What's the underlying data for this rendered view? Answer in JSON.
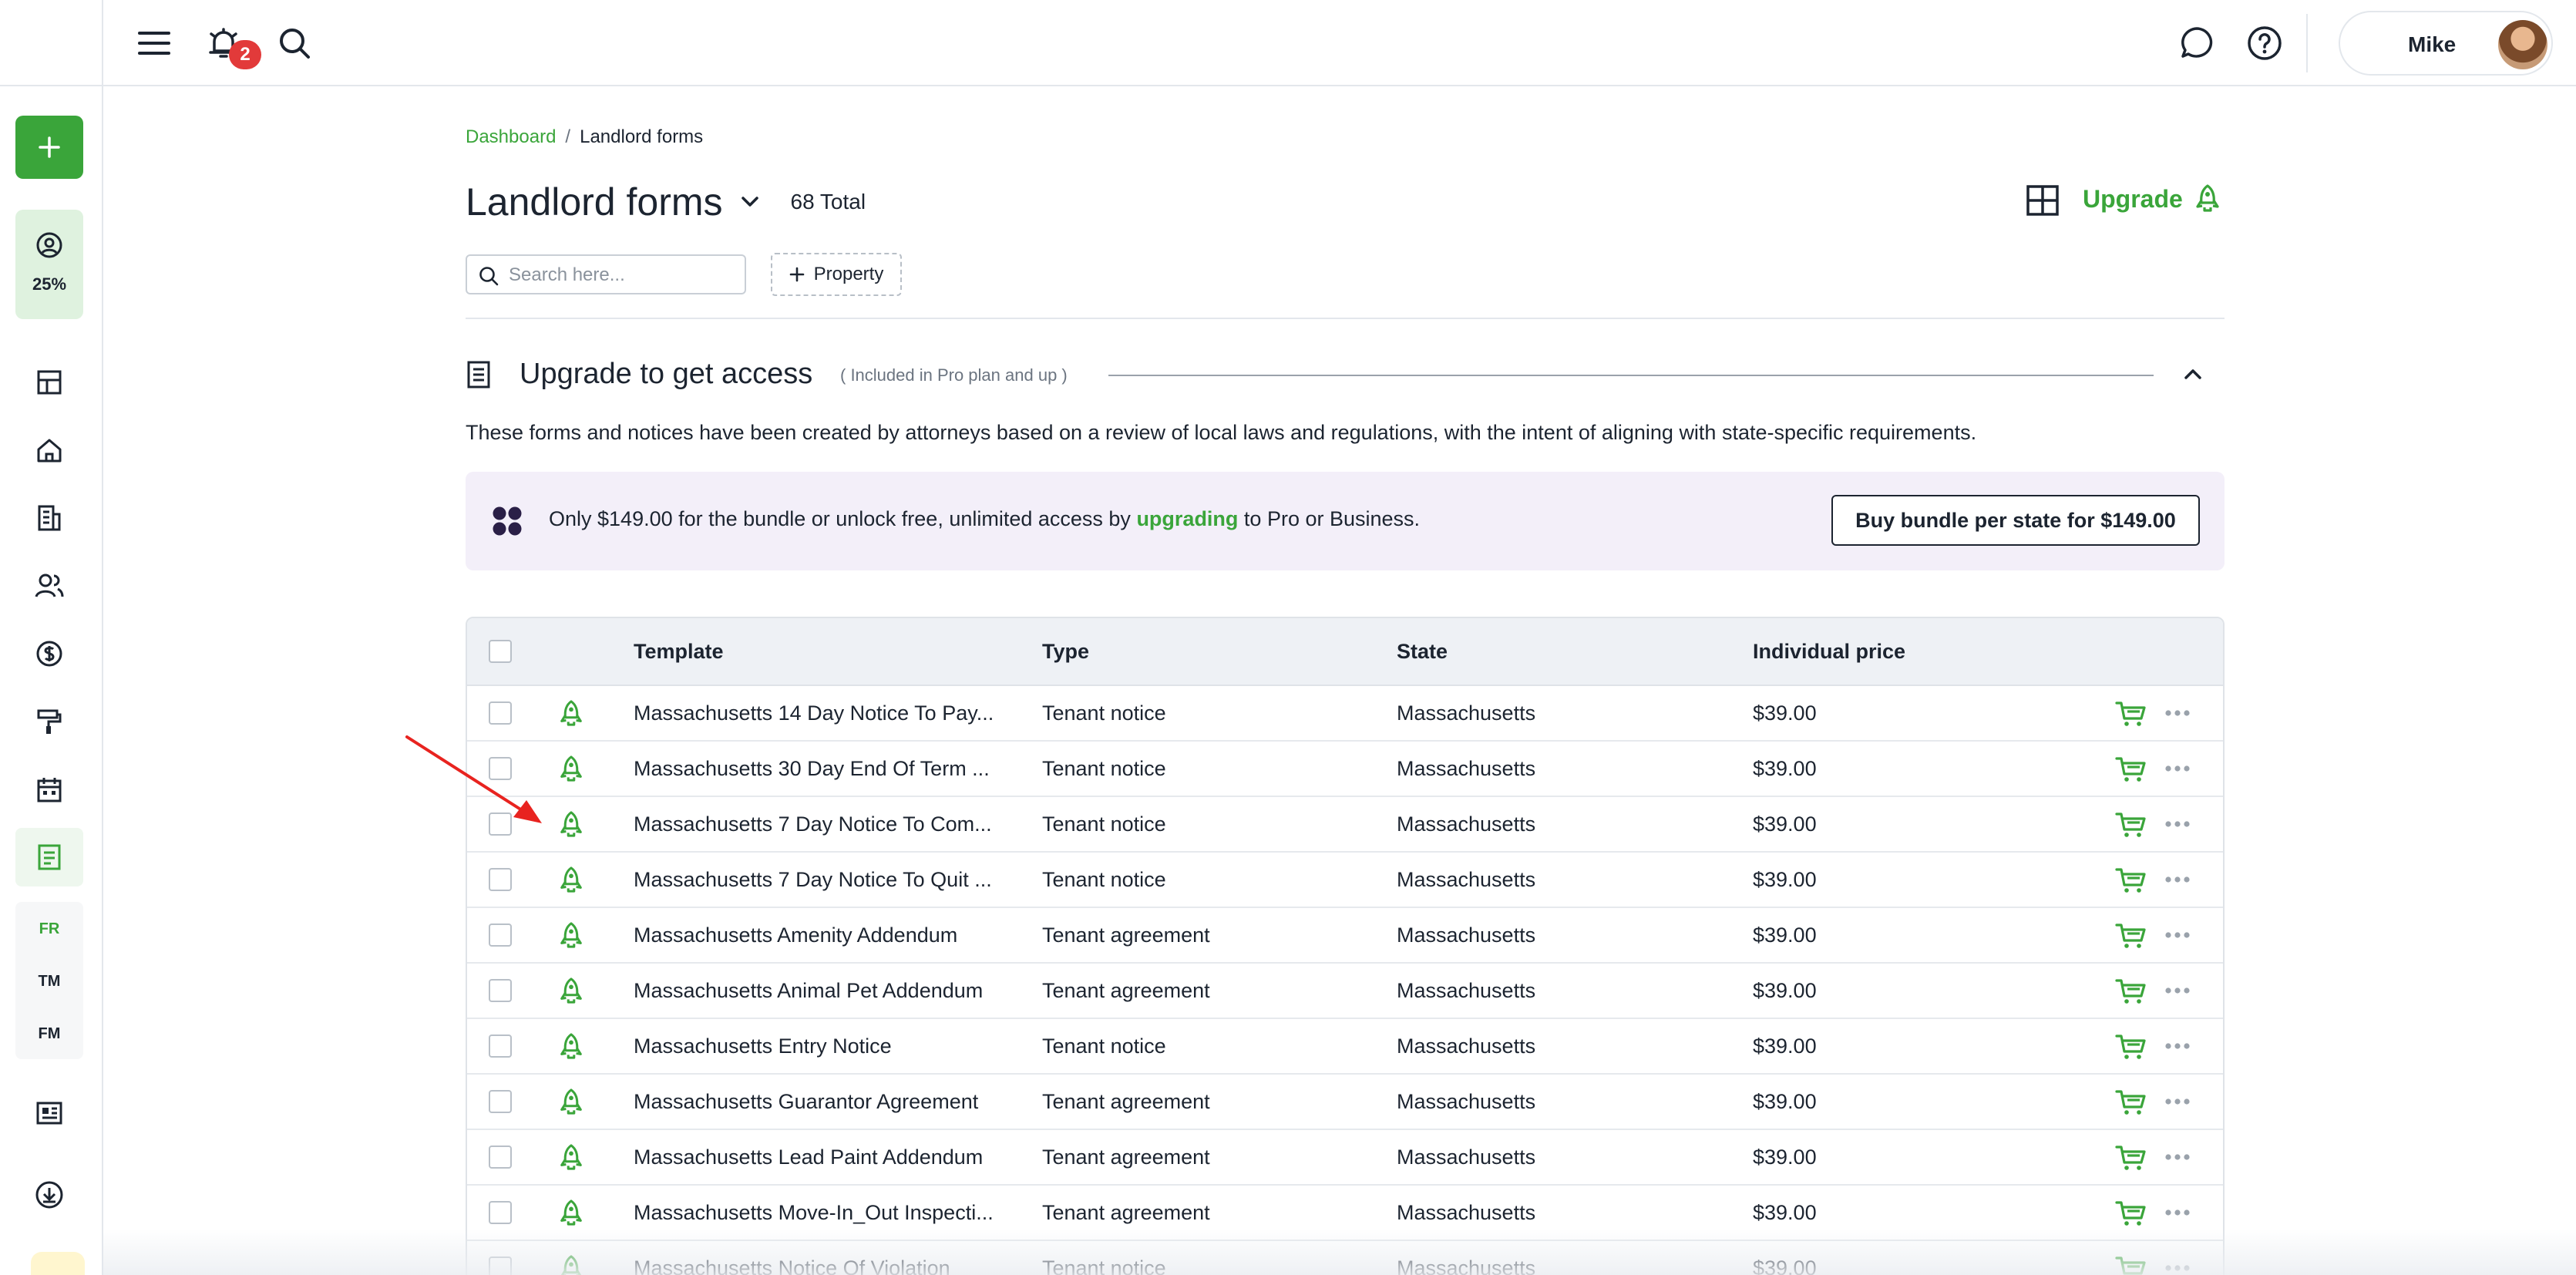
{
  "topbar": {
    "notification_count": "2",
    "user_name": "Mike"
  },
  "sidebar": {
    "progress_label": "25%",
    "tags": [
      "FR",
      "TM",
      "FM"
    ]
  },
  "breadcrumb": {
    "home": "Dashboard",
    "separator": "/",
    "current": "Landlord forms"
  },
  "page": {
    "title": "Landlord forms",
    "total": "68 Total",
    "upgrade_label": "Upgrade",
    "search_placeholder": "Search here...",
    "property_filter_label": "Property"
  },
  "section": {
    "title": "Upgrade to get access",
    "note": "( Included in Pro plan and up )",
    "description": "These forms and notices have been created by attorneys based on a review of local laws and regulations, with the intent of aligning with state-specific requirements."
  },
  "banner": {
    "text_before": "Only $149.00 for the bundle or unlock free, unlimited access by ",
    "link_text": "upgrading",
    "text_after": " to Pro or Business.",
    "button_label": "Buy bundle per state for $149.00"
  },
  "table": {
    "columns": [
      "Template",
      "Type",
      "State",
      "Individual price"
    ],
    "rows": [
      {
        "template": "Massachusetts 14 Day Notice To Pay...",
        "type": "Tenant notice",
        "state": "Massachusetts",
        "price": "$39.00"
      },
      {
        "template": "Massachusetts 30 Day End Of Term ...",
        "type": "Tenant notice",
        "state": "Massachusetts",
        "price": "$39.00"
      },
      {
        "template": "Massachusetts 7 Day Notice To Com...",
        "type": "Tenant notice",
        "state": "Massachusetts",
        "price": "$39.00"
      },
      {
        "template": "Massachusetts 7 Day Notice To Quit ...",
        "type": "Tenant notice",
        "state": "Massachusetts",
        "price": "$39.00"
      },
      {
        "template": "Massachusetts Amenity Addendum",
        "type": "Tenant agreement",
        "state": "Massachusetts",
        "price": "$39.00"
      },
      {
        "template": "Massachusetts Animal Pet Addendum",
        "type": "Tenant agreement",
        "state": "Massachusetts",
        "price": "$39.00"
      },
      {
        "template": "Massachusetts Entry Notice",
        "type": "Tenant notice",
        "state": "Massachusetts",
        "price": "$39.00"
      },
      {
        "template": "Massachusetts Guarantor Agreement",
        "type": "Tenant agreement",
        "state": "Massachusetts",
        "price": "$39.00"
      },
      {
        "template": "Massachusetts Lead Paint Addendum",
        "type": "Tenant agreement",
        "state": "Massachusetts",
        "price": "$39.00"
      },
      {
        "template": "Massachusetts Move-In_Out Inspecti...",
        "type": "Tenant agreement",
        "state": "Massachusetts",
        "price": "$39.00"
      },
      {
        "template": "Massachusetts Notice Of Violation",
        "type": "Tenant notice",
        "state": "Massachusetts",
        "price": "$39.00"
      }
    ]
  },
  "colors": {
    "accent_green": "#3aa53a",
    "badge_red": "#e23a3a",
    "banner_bg": "#f3eff9",
    "annotation_arrow": "#e8231f"
  },
  "icons": [
    "menu-icon",
    "bell-icon",
    "search-icon",
    "chat-icon",
    "help-icon",
    "plus-icon",
    "user-circle-icon",
    "dashboard-icon",
    "home-icon",
    "building-icon",
    "people-icon",
    "dollar-icon",
    "paint-roller-icon",
    "calendar-icon",
    "forms-icon",
    "news-icon",
    "download-cloud-icon",
    "grid-view-icon",
    "rocket-icon",
    "document-icon",
    "chevron-up-icon",
    "chevron-down-icon",
    "cart-icon",
    "more-icon"
  ]
}
